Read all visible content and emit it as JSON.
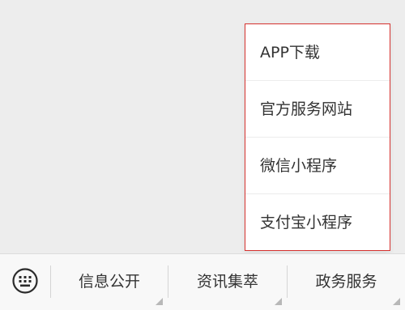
{
  "popup_menu": {
    "items": [
      {
        "label": "APP下载"
      },
      {
        "label": "官方服务网站"
      },
      {
        "label": "微信小程序"
      },
      {
        "label": "支付宝小程序"
      }
    ],
    "border_color": "#d6322f"
  },
  "bottom_menu": {
    "keyboard_icon": "keyboard-icon",
    "tabs": [
      {
        "label": "信息公开",
        "has_submenu": true
      },
      {
        "label": "资讯集萃",
        "has_submenu": true
      },
      {
        "label": "政务服务",
        "has_submenu": true
      }
    ]
  }
}
